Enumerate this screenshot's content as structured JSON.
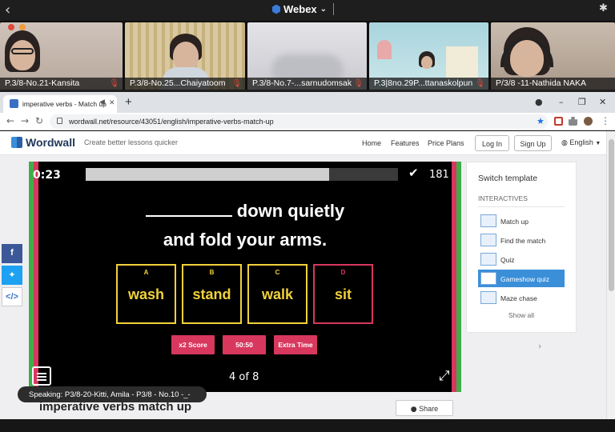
{
  "webex": {
    "title": "Webex"
  },
  "participants": [
    {
      "name": "P.3/8-No.21-Kansita"
    },
    {
      "name": "P.3/8-No.25...Chaiyatoom"
    },
    {
      "name": "P.3/8-No.7-...sarnudomsak"
    },
    {
      "name": "P.3|8no.29P...ttanaskolpun"
    },
    {
      "name": "P/3/8 -11-Nathida NAKA"
    }
  ],
  "browser": {
    "tab_title": "imperative verbs - Match up",
    "url": "wordwall.net/resource/43051/english/imperative-verbs-match-up"
  },
  "wordwall": {
    "logo": "Wordwall",
    "tagline": "Create better lessons quicker",
    "nav": [
      "Home",
      "Features",
      "Price Plans"
    ],
    "login": "Log In",
    "signup": "Sign Up",
    "language": "English"
  },
  "game": {
    "timer": "0:23",
    "progress": 0.78,
    "score": "181",
    "question_line1": "down quietly",
    "question_line2": "and fold your arms.",
    "answers": [
      {
        "letter": "A",
        "word": "wash"
      },
      {
        "letter": "B",
        "word": "stand"
      },
      {
        "letter": "C",
        "word": "walk"
      },
      {
        "letter": "D",
        "word": "sit"
      }
    ],
    "powerups": [
      "x2 Score",
      "50:50",
      "Extra Time"
    ],
    "counter": "4 of 8"
  },
  "panel": {
    "title": "Switch template",
    "subtitle": "INTERACTIVES",
    "templates": [
      "Match up",
      "Find the match",
      "Quiz",
      "Gameshow quiz",
      "Maze chase"
    ],
    "active_index": 3,
    "show_all": "Show all"
  },
  "lesson": {
    "title": "imperative verbs match up",
    "share": "Share"
  },
  "speaking": "Speaking: P3/8-20-Kitti, Amila - P3/8 - No.10 -_-",
  "colors": {
    "accent_yellow": "#f1d23a",
    "accent_red": "#d8375e",
    "accent_green": "#3fae49",
    "active_blue": "#3b8fd9"
  }
}
